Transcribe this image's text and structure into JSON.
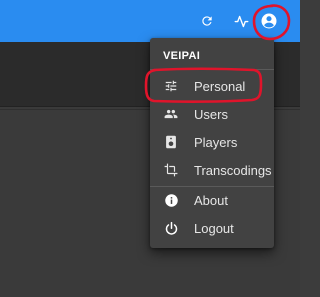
{
  "colors": {
    "appbar": "#2a8cf0",
    "menu_bg": "#424242",
    "annotation": "#e0142b"
  },
  "appbar": {
    "icons": [
      "refresh-icon",
      "activity-icon",
      "account-circle-icon"
    ]
  },
  "menu": {
    "header": "VEIPAI",
    "items": [
      {
        "label": "Personal",
        "icon": "tune-icon"
      },
      {
        "label": "Users",
        "icon": "people-icon"
      },
      {
        "label": "Players",
        "icon": "speaker-icon"
      },
      {
        "label": "Transcodings",
        "icon": "crop-icon"
      },
      {
        "label": "About",
        "icon": "info-icon"
      },
      {
        "label": "Logout",
        "icon": "power-icon"
      }
    ]
  }
}
